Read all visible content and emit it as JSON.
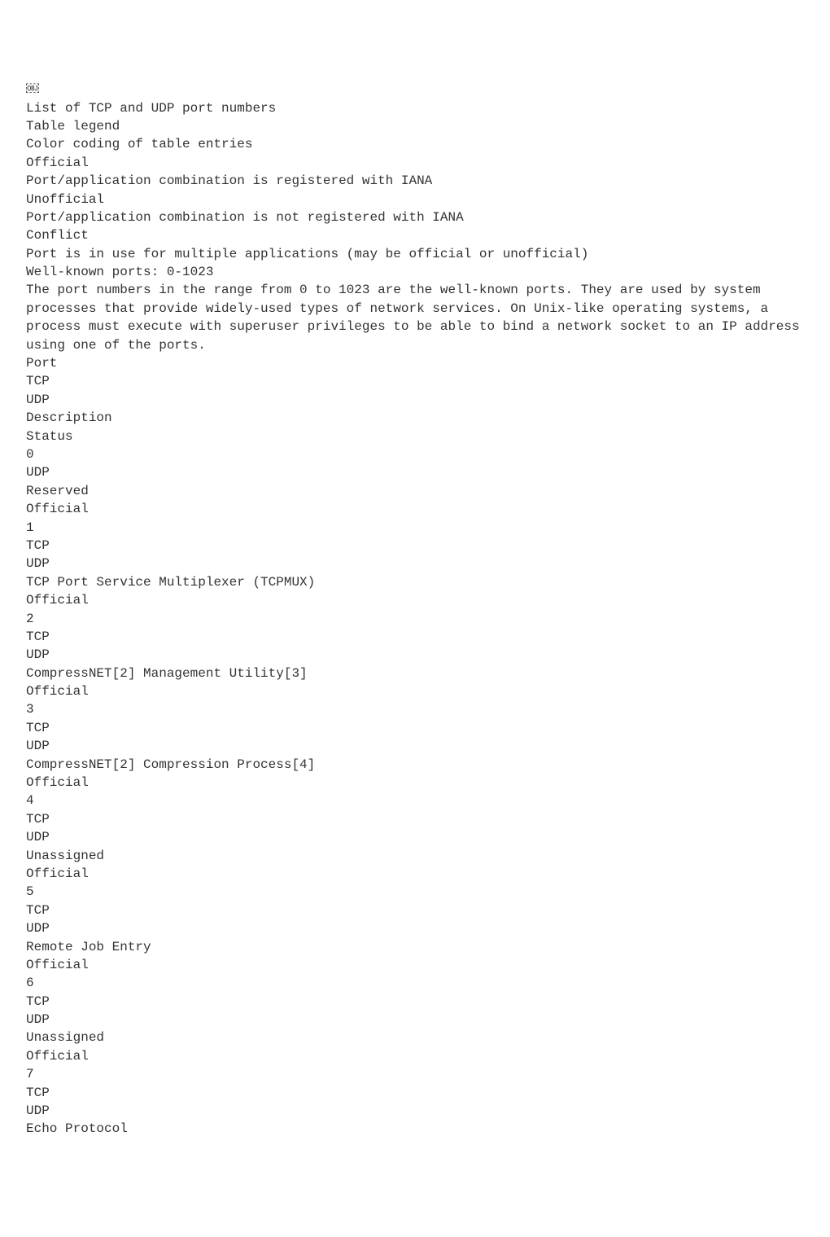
{
  "lines": [
    "￼",
    "List of TCP and UDP port numbers",
    "Table legend",
    "Color coding of table entries",
    "Official",
    "Port/application combination is registered with IANA",
    "Unofficial",
    "Port/application combination is not registered with IANA",
    "Conflict",
    "Port is in use for multiple applications (may be official or unofficial)",
    "Well-known ports: 0-1023",
    "The port numbers in the range from 0 to 1023 are the well-known ports. They are used by system processes that provide widely-used types of network services. On Unix-like operating systems, a process must execute with superuser privileges to be able to bind a network socket to an IP address using one of the ports.",
    "",
    "Port",
    "TCP",
    "UDP",
    "Description",
    "Status",
    "0",
    "",
    "UDP",
    "Reserved",
    "Official",
    "1",
    "TCP",
    "UDP",
    "TCP Port Service Multiplexer (TCPMUX)",
    "Official",
    "2",
    "TCP",
    "UDP",
    "CompressNET[2] Management Utility[3]",
    "Official",
    "3",
    "TCP",
    "UDP",
    "CompressNET[2] Compression Process[4]",
    "Official",
    "4",
    "TCP",
    "UDP",
    "Unassigned",
    "Official",
    "5",
    "TCP",
    "UDP",
    "Remote Job Entry",
    "Official",
    "6",
    "TCP",
    "UDP",
    "Unassigned",
    "Official",
    "7",
    "TCP",
    "UDP",
    "Echo Protocol"
  ]
}
